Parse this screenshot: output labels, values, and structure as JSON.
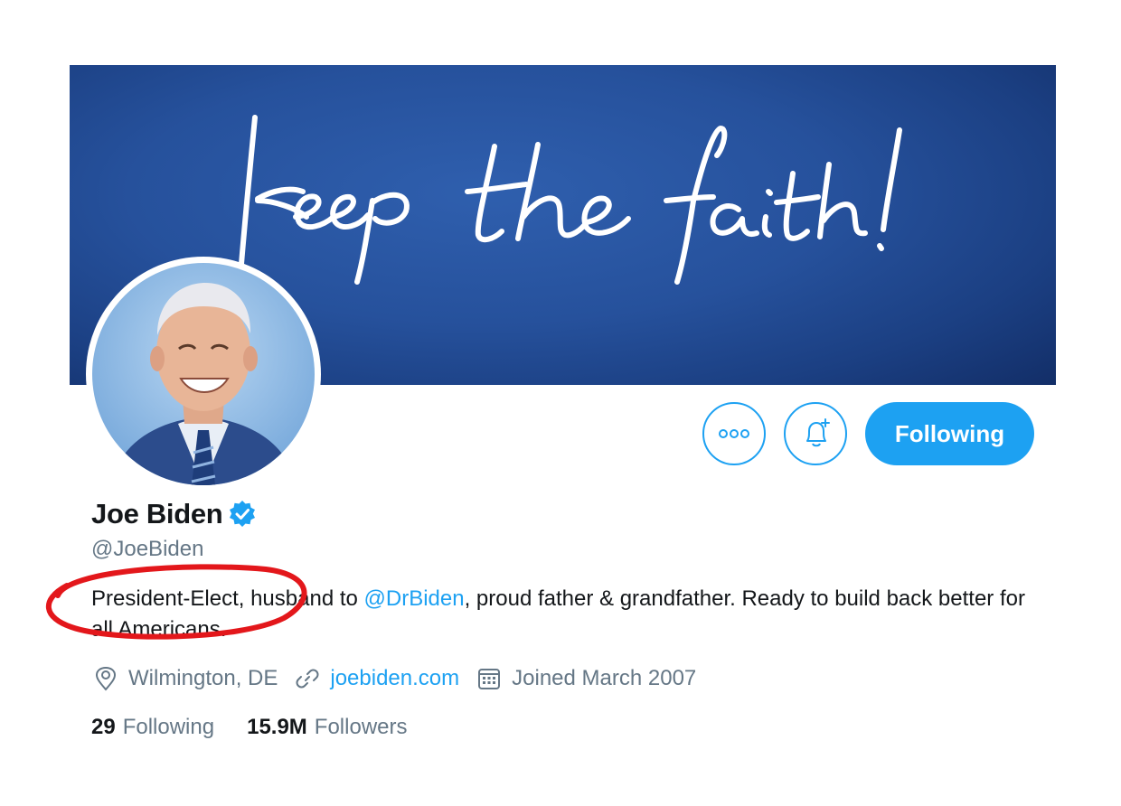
{
  "banner": {
    "handwritten_text": "Keep the faith!",
    "background_color": "#26519c"
  },
  "profile": {
    "name": "Joe Biden",
    "verified_icon": "verified-badge-icon",
    "handle": "@JoeBiden",
    "bio": {
      "before_mention": "President-Elect, husband to ",
      "mention": "@DrBiden",
      "after_mention": ", proud father & grandfather. Ready to build back better for all Americans."
    },
    "location": "Wilmington, DE",
    "website": "joebiden.com",
    "joined": "Joined March 2007",
    "following_count": "29",
    "following_label": "Following",
    "followers_count": "15.9M",
    "followers_label": "Followers"
  },
  "actions": {
    "more_icon": "more-options-icon",
    "notify_icon": "bell-add-icon",
    "follow_label": "Following"
  },
  "annotation": {
    "shape": "red-ellipse",
    "color": "#e3171b"
  },
  "colors": {
    "accent": "#1da1f2",
    "secondary_text": "#657786",
    "primary_text": "#14171a"
  }
}
